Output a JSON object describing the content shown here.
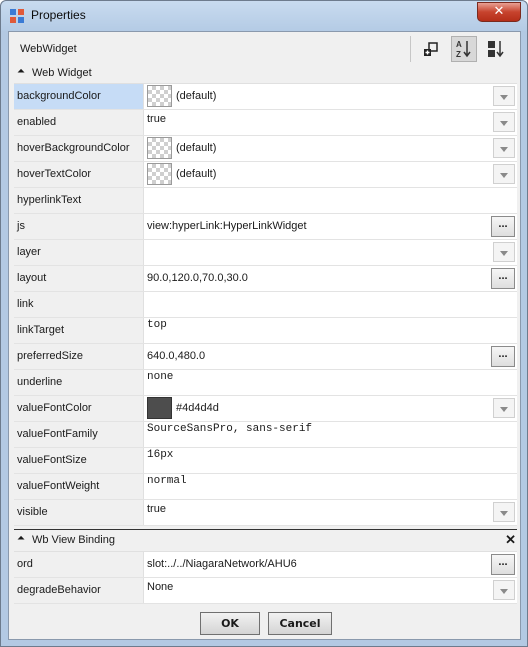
{
  "window": {
    "title": "Properties",
    "close_label": "✕"
  },
  "toolbar": {
    "title": "WebWidget"
  },
  "sections": {
    "web_widget": {
      "label": "Web Widget",
      "collapse_glyph": "⏶"
    },
    "wb_view_binding": {
      "label": "Wb View Binding",
      "collapse_glyph": "⏶",
      "close_glyph": "✕"
    }
  },
  "web_widget_rows": [
    {
      "name": "backgroundColor",
      "value": "(default)",
      "editor": "swatch-dropdown",
      "selected": true
    },
    {
      "name": "enabled",
      "value": "true",
      "editor": "dropdown"
    },
    {
      "name": "hoverBackgroundColor",
      "value": "(default)",
      "editor": "swatch-dropdown"
    },
    {
      "name": "hoverTextColor",
      "value": "(default)",
      "editor": "swatch-dropdown"
    },
    {
      "name": "hyperlinkText",
      "value": "",
      "editor": "text"
    },
    {
      "name": "js",
      "value": "view:hyperLink:HyperLinkWidget",
      "editor": "ellipsis"
    },
    {
      "name": "layer",
      "value": "",
      "editor": "dropdown"
    },
    {
      "name": "layout",
      "value": "90.0,120.0,70.0,30.0",
      "editor": "ellipsis"
    },
    {
      "name": "link",
      "value": "",
      "editor": "text"
    },
    {
      "name": "linkTarget",
      "value": "top",
      "editor": "mono"
    },
    {
      "name": "preferredSize",
      "value": "640.0,480.0",
      "editor": "ellipsis"
    },
    {
      "name": "underline",
      "value": "none",
      "editor": "mono"
    },
    {
      "name": "valueFontColor",
      "value": "#4d4d4d",
      "editor": "solid-swatch-dropdown",
      "color": "#4d4d4d"
    },
    {
      "name": "valueFontFamily",
      "value": "SourceSansPro, sans-serif",
      "editor": "mono"
    },
    {
      "name": "valueFontSize",
      "value": "16px",
      "editor": "mono"
    },
    {
      "name": "valueFontWeight",
      "value": "normal",
      "editor": "mono"
    },
    {
      "name": "visible",
      "value": "true",
      "editor": "dropdown"
    }
  ],
  "binding_rows": [
    {
      "name": "ord",
      "value": "slot:../../NiagaraNetwork/AHU6",
      "editor": "ellipsis"
    },
    {
      "name": "degradeBehavior",
      "value": "None",
      "editor": "dropdown"
    }
  ],
  "footer": {
    "ok_label": "OK",
    "cancel_label": "Cancel"
  },
  "colors": {
    "selected_row": "#c6dcf6",
    "title_bar": "#b9cfe8",
    "close_button": "#c7432d"
  },
  "ellipsis_label": "..."
}
